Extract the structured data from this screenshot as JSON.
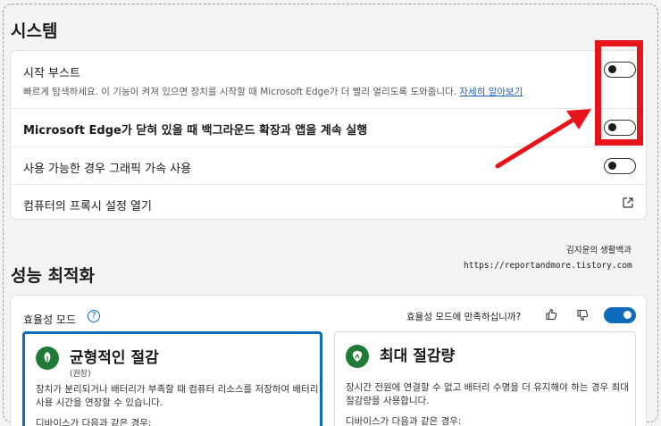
{
  "system": {
    "title": "시스템",
    "rows": [
      {
        "label": "시작 부스트",
        "description": "빠르게 탐색하세요. 이 기능이 켜져 있으면 장치를 시작할 때 Microsoft Edge가 더 빨리 열리도록 도와줍니다.",
        "link": "자세히 알아보기",
        "toggle": "off"
      },
      {
        "label": "Microsoft Edge가 닫혀 있을 때 백그라운드 확장과 앱을 계속 실행",
        "toggle": "off"
      },
      {
        "label": "사용 가능한 경우 그래픽 가속 사용",
        "toggle": "off"
      },
      {
        "label": "컴퓨터의 프록시 설정 열기",
        "icon": "external-link-icon"
      }
    ]
  },
  "watermark": {
    "line1": "김지윤의 생활백과",
    "line2": "https://reportandmore.tistory.com"
  },
  "performance": {
    "title": "성능 최적화",
    "efficiency_mode_label": "효율성 모드",
    "feedback_question": "효율성 모드에 만족하십니까?",
    "efficiency_toggle": "on",
    "options": [
      {
        "title": "균형적인 절감",
        "subtitle": "(권장)",
        "description": "장치가 분리되거나 배터리가 부족할 때 컴퓨터 리소스를 저장하여 배터리 사용 시간을 연장할 수 있습니다.",
        "footer": "디바이스가 다음과 같은 경우:",
        "selected": true
      },
      {
        "title": "최대 절감량",
        "description": "장시간 전원에 연결할 수 없고 배터리 수명을 더 유지해야 하는 경우 최대 절감량을 사용합니다.",
        "footer": "디바이스가 다음과 같은 경우:",
        "selected": false
      }
    ]
  },
  "colors": {
    "accent": "#0f6cbd",
    "highlight": "#e8141c",
    "leaf_green": "#1e7a35"
  }
}
